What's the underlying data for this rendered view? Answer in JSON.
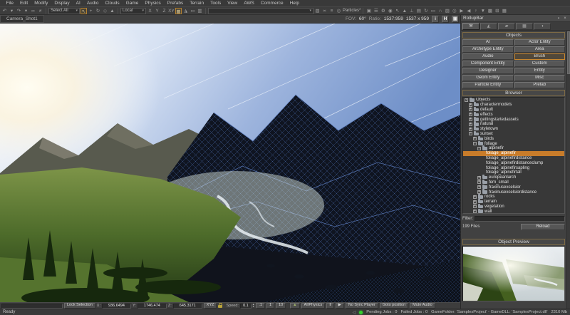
{
  "colors": {
    "accent_orange": "#cf7f2c",
    "selection_orange": "#c87c2a",
    "status_green": "#35d02e",
    "panel_bg": "#414141"
  },
  "menu": {
    "items": [
      {
        "label": "File"
      },
      {
        "label": "Edit"
      },
      {
        "label": "Modify"
      },
      {
        "label": "Display"
      },
      {
        "label": "AI"
      },
      {
        "label": "Audio"
      },
      {
        "label": "Clouds"
      },
      {
        "label": "Game"
      },
      {
        "label": "Physics"
      },
      {
        "label": "Prefabs"
      },
      {
        "label": "Terrain"
      },
      {
        "label": "Tools"
      },
      {
        "label": "View"
      },
      {
        "label": "AWS"
      },
      {
        "label": "Commerce"
      },
      {
        "label": "Help"
      }
    ]
  },
  "toolbar": {
    "undo_group": [
      {
        "name": "undo-icon",
        "glyph": "↶"
      },
      {
        "name": "undo-history-dropdown-icon",
        "glyph": "▾"
      },
      {
        "name": "redo-icon",
        "glyph": "↷"
      },
      {
        "name": "redo-history-dropdown-icon",
        "glyph": "▾"
      },
      {
        "name": "link-objects-icon",
        "glyph": "∞"
      },
      {
        "name": "unlink-objects-icon",
        "glyph": "≠"
      }
    ],
    "select_all_label": "Select All",
    "tool_group": [
      {
        "name": "select-tool-icon",
        "glyph": "↖",
        "cls": "hl"
      },
      {
        "name": "move-tool-icon",
        "glyph": "+"
      },
      {
        "name": "rotate-tool-icon",
        "glyph": "↻"
      },
      {
        "name": "scale-tool-icon",
        "glyph": "◇"
      },
      {
        "name": "follow-terrain-icon",
        "glyph": "▲"
      }
    ],
    "local_label": "Local",
    "axis_group": [
      {
        "name": "axis-x-button",
        "glyph": "X"
      },
      {
        "name": "axis-y-button",
        "glyph": "Y"
      },
      {
        "name": "axis-z-button",
        "glyph": "Z"
      },
      {
        "name": "axis-xy-button",
        "glyph": "XY"
      }
    ],
    "snap_group": [
      {
        "name": "grid-snap-icon",
        "glyph": "▦",
        "cls": "hl"
      },
      {
        "name": "angle-snap-icon",
        "glyph": "◮"
      },
      {
        "name": "ruler-icon",
        "glyph": "▭"
      },
      {
        "name": "selection-mask-icon",
        "glyph": "▥"
      }
    ],
    "named_selection_value": "",
    "mask_group": [
      {
        "name": "freeze-mask-icon",
        "glyph": "▧"
      },
      {
        "name": "hide-mask-icon",
        "glyph": "≍"
      },
      {
        "name": "mask-list-icon",
        "glyph": "≡"
      }
    ],
    "particles_icon": "◎",
    "particles_label": "Particles*",
    "right_strip": [
      {
        "name": "layout-icon",
        "glyph": "▣"
      },
      {
        "name": "console-icon",
        "glyph": "☰"
      },
      {
        "name": "settings-icon",
        "glyph": "⚙"
      },
      {
        "name": "target-icon",
        "glyph": "◉"
      },
      {
        "name": "pick-icon",
        "glyph": "↖"
      },
      {
        "name": "terrain-editor-icon",
        "glyph": "▲"
      },
      {
        "name": "physics-tool-icon",
        "glyph": "⊥"
      },
      {
        "name": "layers-panel-icon",
        "glyph": "▤"
      },
      {
        "name": "reload-scripts-icon",
        "glyph": "↻"
      },
      {
        "name": "measure-icon",
        "glyph": "▭"
      },
      {
        "name": "tunnel-icon",
        "glyph": "∩"
      },
      {
        "name": "material-editor-icon",
        "glyph": "▨"
      },
      {
        "name": "record-icon",
        "glyph": "◎"
      },
      {
        "name": "play-icon",
        "glyph": "▶"
      },
      {
        "name": "back-icon",
        "glyph": "◀"
      },
      {
        "name": "character-editor-icon",
        "glyph": "♀"
      },
      {
        "name": "dropdown-icon",
        "glyph": "▼"
      },
      {
        "name": "texture-browser-icon",
        "glyph": "▩"
      },
      {
        "name": "new-window-icon",
        "glyph": "⊞"
      },
      {
        "name": "mesh-icon",
        "glyph": "▦"
      }
    ]
  },
  "viewport": {
    "camera_label": "Camera_Shot1",
    "fov_label": "FOV:",
    "fov_value": "60°",
    "ratio_label": "Ratio:",
    "ratio_value": "1537:959",
    "resolution": "1537 x 959",
    "info_button": "i",
    "h_button": "H",
    "float_button": "▣"
  },
  "rollupbar": {
    "title": "RollupBar",
    "pin_icon": "▪",
    "close_icon": "×",
    "tabs": [
      {
        "name": "tab-objects",
        "glyph": "⚒",
        "cls": "active"
      },
      {
        "name": "tab-terrain",
        "glyph": "◭"
      },
      {
        "name": "tab-terrain-texture",
        "glyph": "▰"
      },
      {
        "name": "tab-display",
        "glyph": "▦"
      },
      {
        "name": "tab-layers",
        "glyph": "◑"
      }
    ],
    "objects_header": "Objects",
    "object_buttons": [
      {
        "name": "ai-button",
        "label": "AI"
      },
      {
        "name": "actor-entity-button",
        "label": "Actor Entity"
      },
      {
        "name": "archetype-entity-button",
        "label": "Archetype Entity"
      },
      {
        "name": "area-button",
        "label": "Area"
      },
      {
        "name": "audio-button",
        "label": "Audio"
      },
      {
        "name": "brush-button",
        "label": "Brush",
        "cls": "selected"
      },
      {
        "name": "component-entity-button",
        "label": "Component Entity"
      },
      {
        "name": "custom-button",
        "label": "Custom"
      },
      {
        "name": "designer-button",
        "label": "Designer"
      },
      {
        "name": "entity-button",
        "label": "Entity"
      },
      {
        "name": "geom-entity-button",
        "label": "Geom Entity"
      },
      {
        "name": "misc-button",
        "label": "Misc"
      },
      {
        "name": "particle-entity-button",
        "label": "Particle Entity"
      },
      {
        "name": "prefab-button",
        "label": "Prefab"
      }
    ],
    "browser_header": "Browser",
    "tree_items": [
      {
        "level": 0,
        "toggle": "-",
        "label": "Objects"
      },
      {
        "level": 1,
        "toggle": "+",
        "label": "charactermodels"
      },
      {
        "level": 1,
        "toggle": "+",
        "label": "default"
      },
      {
        "level": 1,
        "toggle": "+",
        "label": "effects"
      },
      {
        "level": 1,
        "toggle": "+",
        "label": "gettingstartedassets"
      },
      {
        "level": 1,
        "toggle": "+",
        "label": "natural"
      },
      {
        "level": 1,
        "toggle": "+",
        "label": "styletown"
      },
      {
        "level": 1,
        "toggle": "-",
        "label": "sunset"
      },
      {
        "level": 2,
        "toggle": "+",
        "label": "birds"
      },
      {
        "level": 2,
        "toggle": "-",
        "label": "foliage"
      },
      {
        "level": 3,
        "toggle": "-",
        "label": "alpinefir"
      },
      {
        "level": 4,
        "toggle": "",
        "label": "foliage_alpinefir",
        "cls": "leaf selected"
      },
      {
        "level": 4,
        "toggle": "",
        "label": "foliage_alpinefirdistance",
        "cls": "leaf"
      },
      {
        "level": 4,
        "toggle": "",
        "label": "foliage_alpinefirdistanceclump",
        "cls": "leaf"
      },
      {
        "level": 4,
        "toggle": "",
        "label": "foliage_alpinefirsapling",
        "cls": "leaf"
      },
      {
        "level": 4,
        "toggle": "",
        "label": "foliage_alpinefirtall",
        "cls": "leaf"
      },
      {
        "level": 3,
        "toggle": "+",
        "label": "europeanlarch"
      },
      {
        "level": 3,
        "toggle": "+",
        "label": "fern_small"
      },
      {
        "level": 3,
        "toggle": "+",
        "label": "fraxinusexcelsior"
      },
      {
        "level": 3,
        "toggle": "+",
        "label": "fraxinusexcelsiordistance"
      },
      {
        "level": 2,
        "toggle": "+",
        "label": "rocks"
      },
      {
        "level": 2,
        "toggle": "+",
        "label": "terrain"
      },
      {
        "level": 2,
        "toggle": "+",
        "label": "vegetation"
      },
      {
        "level": 2,
        "toggle": "+",
        "label": "wall"
      }
    ],
    "filter_label": "Filter:",
    "filter_value": "",
    "files_count": "199 Files",
    "reload_label": "Reload",
    "preview_header": "Object Preview"
  },
  "bottombar": {
    "lock_selection": "Lock Selection",
    "x_label": "X:",
    "x_value": "936.6494",
    "y_label": "Y:",
    "y_value": "1746.474",
    "z_label": "Z:",
    "z_value": "645.3171",
    "xyz_label": "XYZ",
    "speed_label": "Speed:",
    "speed_value": "0.1",
    "preset_01": ".1",
    "preset_1": "1",
    "preset_10": "10",
    "terrain_collision_glyph": "▲",
    "ai_physics": "AI/Physics",
    "pause_glyph": "‖",
    "step_glyph": "▶",
    "no_sync": "No Sync Player",
    "goto_position": "Goto position",
    "mute_audio": "Mute Audio"
  },
  "statusbar": {
    "ready": "Ready",
    "pending": "Pending Jobs : 0",
    "failed": "Failed Jobs : 0",
    "game_info": "GameFolder: 'SamplesProject' - GameDLL: 'SamplesProject.dll'",
    "memory": "2310 Mb"
  }
}
